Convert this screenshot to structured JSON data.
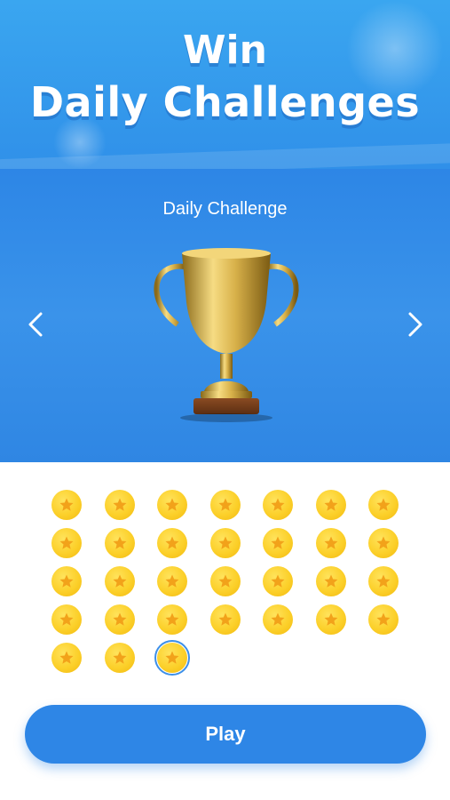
{
  "banner": {
    "line1": "Win",
    "line2": "Daily Challenges"
  },
  "challenge": {
    "label": "Daily Challenge"
  },
  "nav": {
    "prev_icon": "chevron-left-icon",
    "next_icon": "chevron-right-icon"
  },
  "coins": {
    "total": 31,
    "current_index": 30,
    "icon": "star-coin-icon"
  },
  "play_button": {
    "label": "Play"
  },
  "colors": {
    "accent": "#2e86e6",
    "coin": "#fcd02a",
    "star": "#f2a21a"
  }
}
